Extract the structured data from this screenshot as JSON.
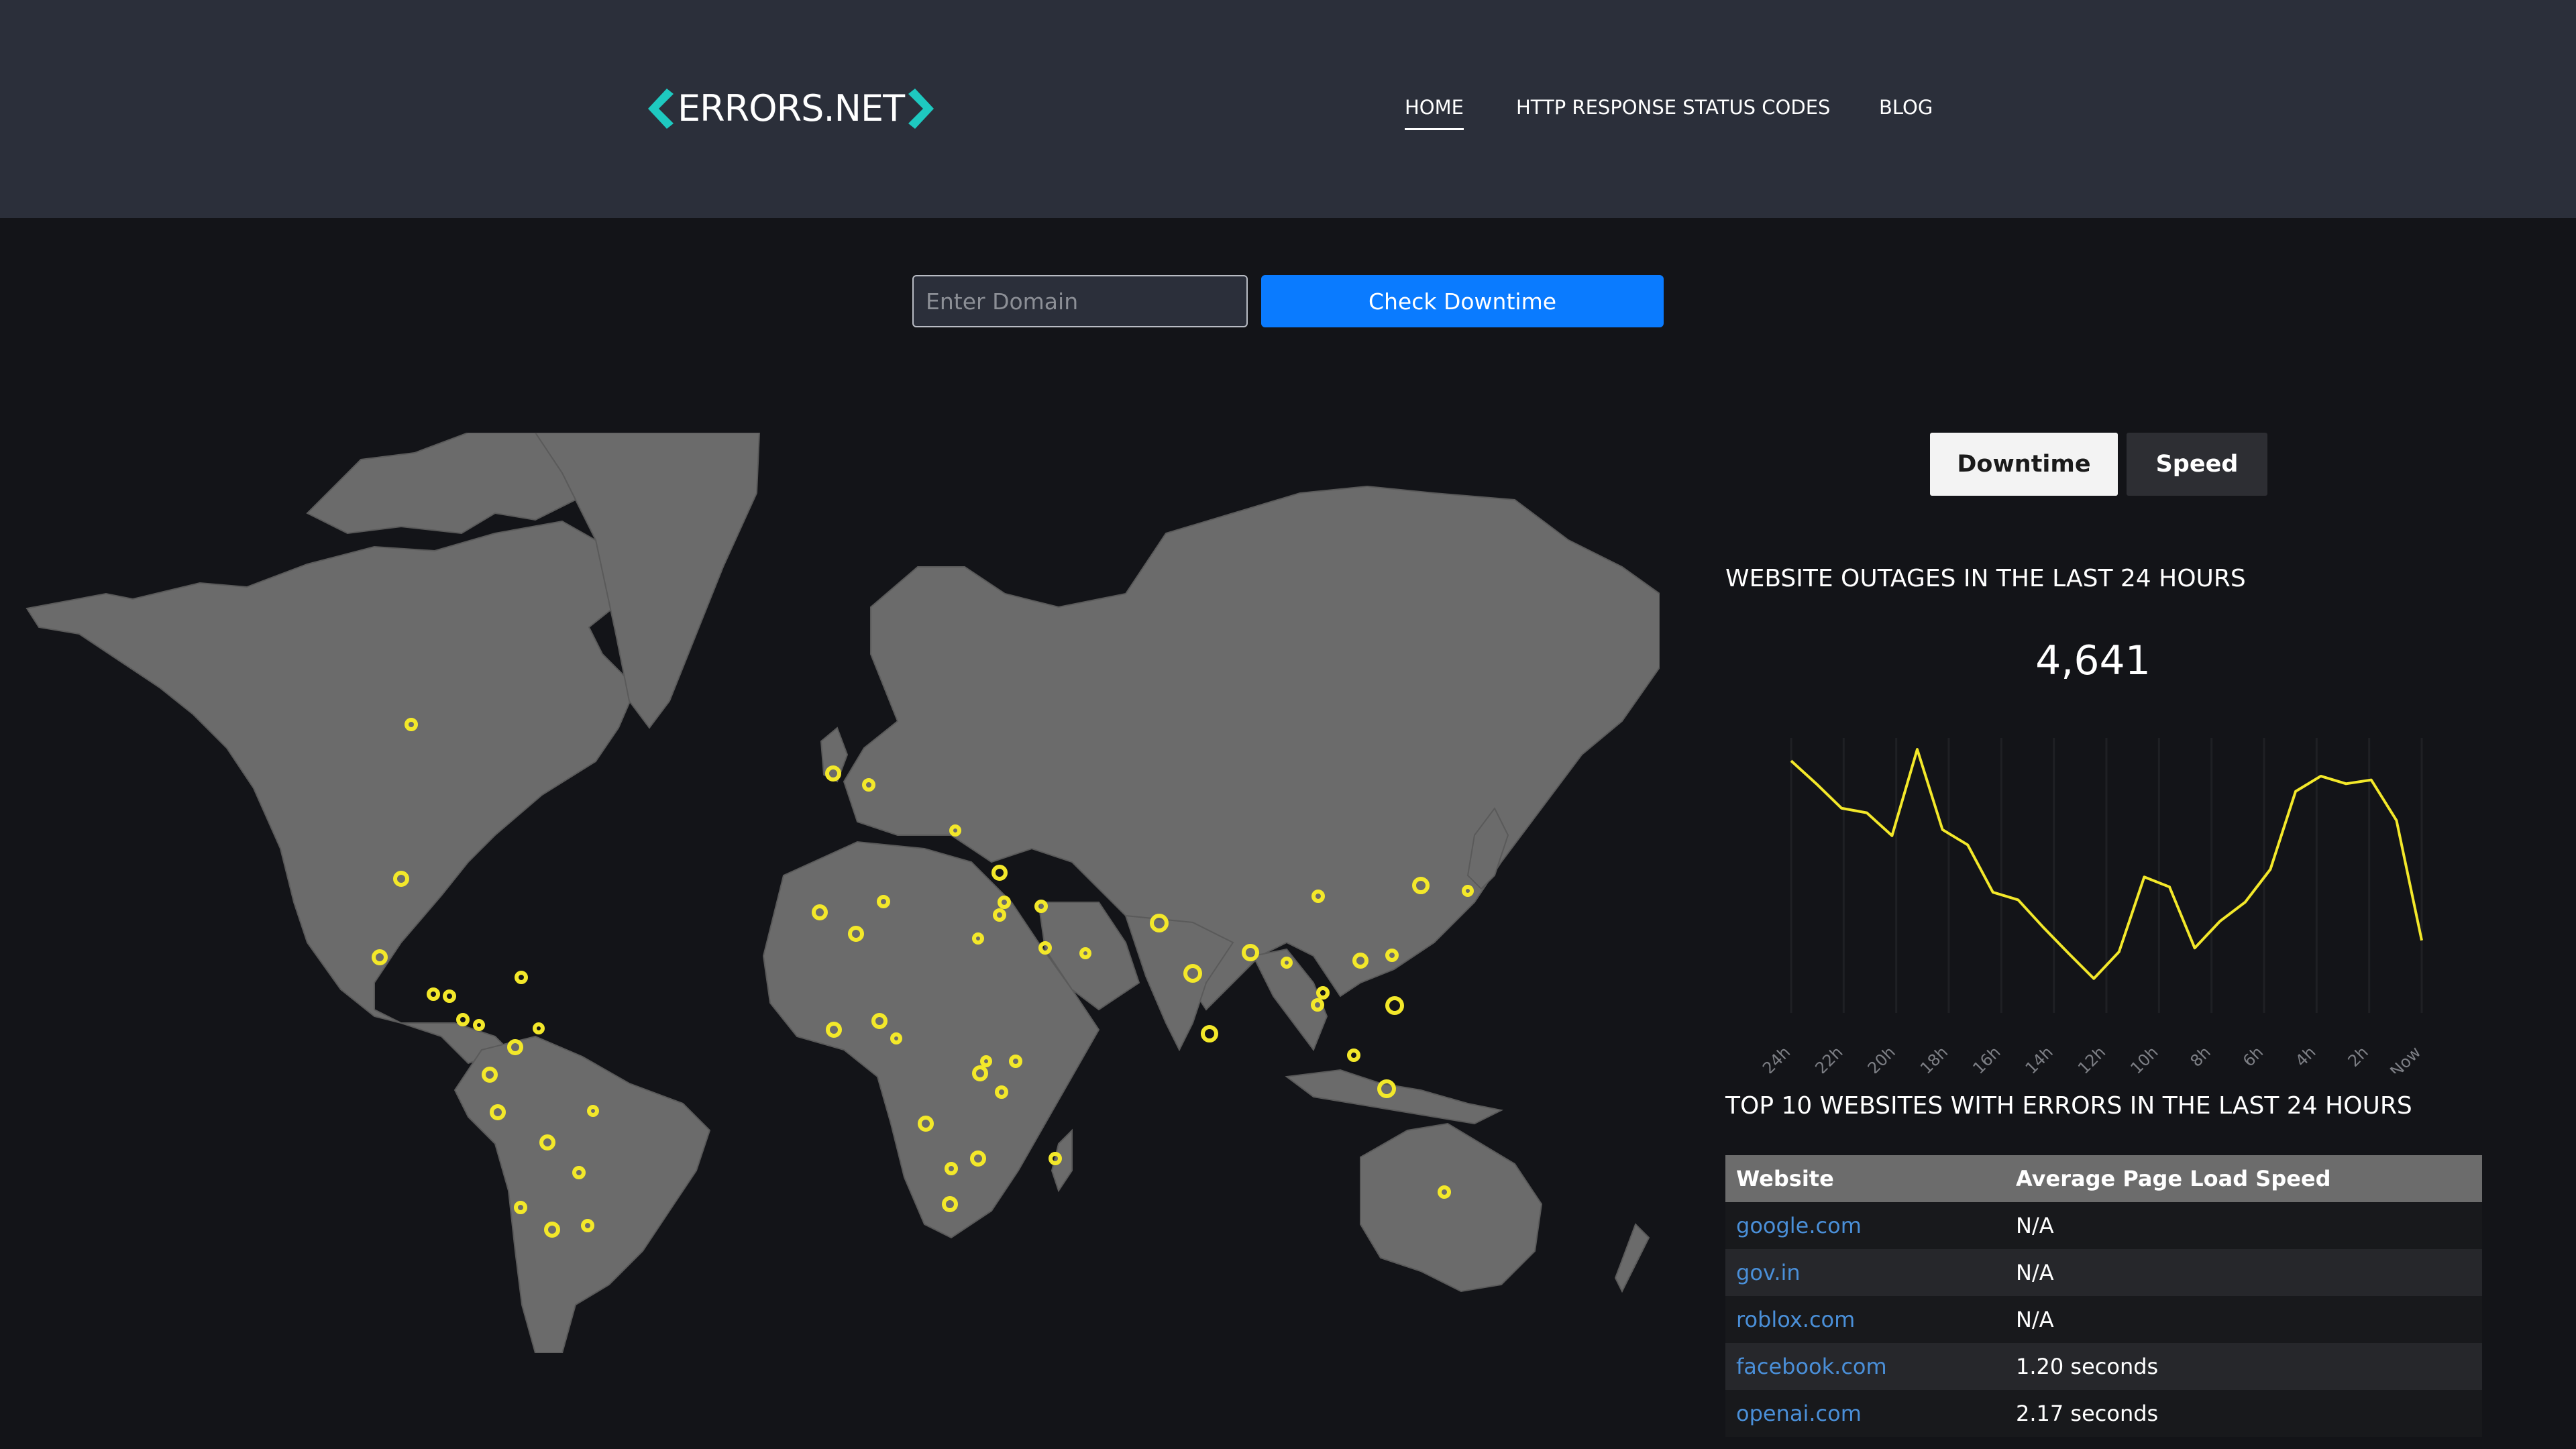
{
  "header": {
    "logo_text": "ERRORS.NET",
    "nav": [
      "HOME",
      "HTTP RESPONSE STATUS CODES",
      "BLOG"
    ]
  },
  "search": {
    "placeholder": "Enter Domain",
    "button": "Check Downtime"
  },
  "toggle": {
    "active": "Downtime",
    "inactive": "Speed"
  },
  "outages": {
    "title": "WEBSITE OUTAGES IN THE LAST 24 HOURS",
    "count": "4,641"
  },
  "chart_data": {
    "type": "line",
    "x": [
      "24h",
      "22h",
      "20h",
      "18h",
      "16h",
      "14h",
      "12h",
      "10h",
      "8h",
      "6h",
      "4h",
      "2h",
      "Now"
    ],
    "series": [
      {
        "values": [
          330,
          300,
          268,
          262,
          232,
          345,
          240,
          220,
          158,
          148,
          112,
          78,
          45,
          80,
          178,
          165,
          85,
          120,
          145,
          188,
          290,
          310,
          300,
          305,
          252,
          95
        ]
      }
    ],
    "ylim": [
      0,
      360
    ],
    "color": "#f3e82a",
    "grid": "vertical"
  },
  "table": {
    "title": "TOP 10 WEBSITES WITH ERRORS IN THE LAST 24 HOURS",
    "headers": [
      "Website",
      "Average Page Load Speed"
    ],
    "rows": [
      [
        "google.com",
        "N/A"
      ],
      [
        "gov.in",
        "N/A"
      ],
      [
        "roblox.com",
        "N/A"
      ],
      [
        "facebook.com",
        "1.20 seconds"
      ],
      [
        "openai.com",
        "2.17 seconds"
      ]
    ]
  },
  "colors": {
    "header_bg": "#2b2f3a",
    "page_bg": "#131418",
    "accent_blue": "#0a7bff",
    "logo_accent": "#1ec9c0",
    "marker": "#f3e82a",
    "land": "#6b6b6b",
    "link": "#4a8fd8"
  },
  "icons": {
    "logo": "chevron-bracket-icon",
    "marker": "outage-marker-icon"
  }
}
